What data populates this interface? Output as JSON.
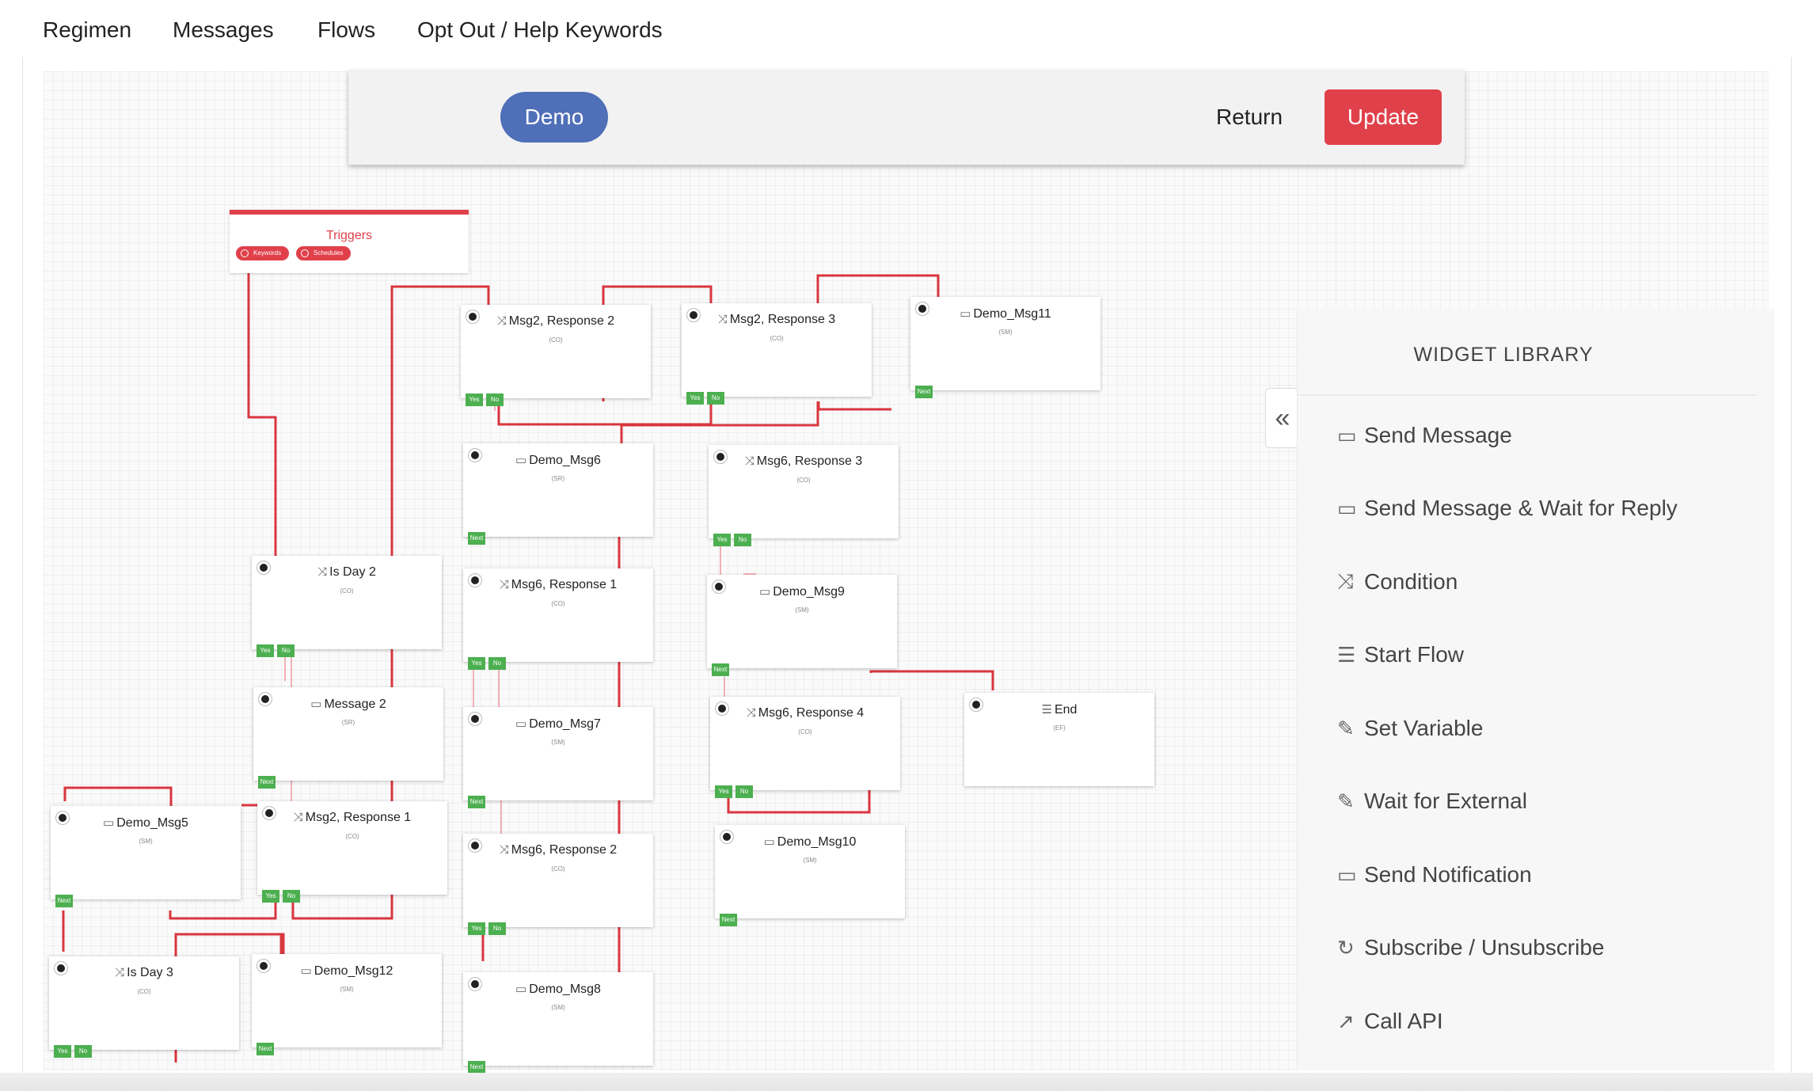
{
  "nav": [
    "Regimen",
    "Messages",
    "Flows",
    "Opt Out / Help Keywords"
  ],
  "toolbar": {
    "flow_name": "Demo",
    "return_label": "Return",
    "update_label": "Update"
  },
  "triggers": {
    "title": "Triggers",
    "keywords_label": "Keywords",
    "schedules_label": "Schedules"
  },
  "nodes": [
    {
      "title": "Msg2, Response 2",
      "tag": "(CO)",
      "icon": "condition-icon"
    },
    {
      "title": "Msg2, Response 3",
      "tag": "(CO)",
      "icon": "condition-icon"
    },
    {
      "title": "Demo_Msg11",
      "tag": "(SM)",
      "icon": "message-icon"
    },
    {
      "title": "Demo_Msg6",
      "tag": "(SR)",
      "icon": "message-icon"
    },
    {
      "title": "Msg6, Response 3",
      "tag": "(CO)",
      "icon": "condition-icon"
    },
    {
      "title": "Is Day 2",
      "tag": "(CO)",
      "icon": "condition-icon"
    },
    {
      "title": "Msg6, Response 1",
      "tag": "(CO)",
      "icon": "condition-icon"
    },
    {
      "title": "Demo_Msg9",
      "tag": "(SM)",
      "icon": "message-icon"
    },
    {
      "title": "Message 2",
      "tag": "(SR)",
      "icon": "message-icon"
    },
    {
      "title": "Demo_Msg7",
      "tag": "(SM)",
      "icon": "message-icon"
    },
    {
      "title": "Msg6, Response 4",
      "tag": "(CO)",
      "icon": "condition-icon"
    },
    {
      "title": "End",
      "tag": "(EF)",
      "icon": "end-flow-icon"
    },
    {
      "title": "Demo_Msg5",
      "tag": "(SM)",
      "icon": "message-icon"
    },
    {
      "title": "Msg2, Response 1",
      "tag": "(CO)",
      "icon": "condition-icon"
    },
    {
      "title": "Demo_Msg10",
      "tag": "(SM)",
      "icon": "message-icon"
    },
    {
      "title": "Msg6, Response 2",
      "tag": "(CO)",
      "icon": "condition-icon"
    },
    {
      "title": "Is Day 3",
      "tag": "(CO)",
      "icon": "condition-icon"
    },
    {
      "title": "Demo_Msg12",
      "tag": "(SM)",
      "icon": "message-icon"
    },
    {
      "title": "Demo_Msg8",
      "tag": "(SM)",
      "icon": "message-icon"
    }
  ],
  "handles": {
    "yes": "Yes",
    "no": "No",
    "next": "Next"
  },
  "widget_library": {
    "title": "WIDGET LIBRARY",
    "items": [
      {
        "label": "Send Message",
        "icon": "message-icon"
      },
      {
        "label": "Send Message & Wait for Reply",
        "icon": "message-icon"
      },
      {
        "label": "Condition",
        "icon": "condition-icon"
      },
      {
        "label": "Start Flow",
        "icon": "start-flow-icon"
      },
      {
        "label": "Set Variable",
        "icon": "pencil-icon"
      },
      {
        "label": "Wait for External",
        "icon": "pencil-icon"
      },
      {
        "label": "Send Notification",
        "icon": "message-icon"
      },
      {
        "label": "Subscribe / Unsubscribe",
        "icon": "refresh-icon"
      },
      {
        "label": "Call API",
        "icon": "arrow-up-right-icon"
      }
    ]
  },
  "colors": {
    "accent_red": "#e0404a",
    "primary_blue": "#4f6fb8",
    "handle_green": "#4caf50"
  }
}
